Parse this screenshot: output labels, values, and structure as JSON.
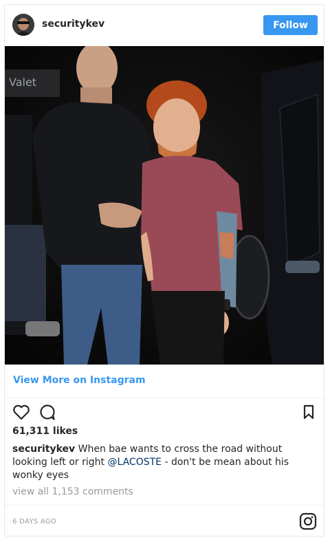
{
  "header": {
    "username": "securitykev",
    "follow_label": "Follow"
  },
  "post": {
    "photo_sign_text": "Valet",
    "view_more_label": "View More on Instagram",
    "likes": "61,311 likes",
    "caption_user": "securitykev",
    "caption_text_1": " When bae wants to cross the road without looking left or right ",
    "caption_mention": "@LACOSTE",
    "caption_text_2": " - don't be mean about his wonky eyes",
    "view_comments": "view all 1,153 comments",
    "timestamp": "6 DAYS AGO"
  },
  "icons": {
    "like": "heart-outline-icon",
    "comment": "comment-bubble-icon",
    "save": "bookmark-icon",
    "brand": "instagram-logo-icon"
  },
  "colors": {
    "accent": "#3897f0",
    "mention": "#003569",
    "muted": "#999999",
    "text": "#262626"
  }
}
